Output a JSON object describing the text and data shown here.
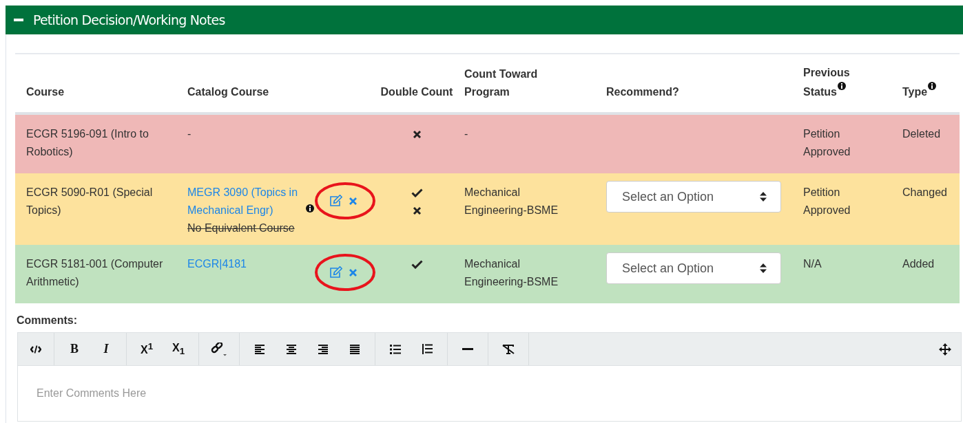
{
  "panel": {
    "title": "Petition Decision/Working Notes",
    "expanded": true
  },
  "table": {
    "columns": [
      {
        "label": "Course"
      },
      {
        "label": "Catalog Course"
      },
      {
        "label": "Double Count"
      },
      {
        "label": "Count Toward Program"
      },
      {
        "label": "Recommend?"
      },
      {
        "label": "Previous Status",
        "info": true
      },
      {
        "label": "Type",
        "info": true
      }
    ],
    "rows": [
      {
        "color": "#efb8b7",
        "course": "ECGR 5196-091 (Intro to Robotics)",
        "catalog": [
          {
            "text": "-",
            "kind": "plain"
          }
        ],
        "actions": false,
        "double_count": [
          {
            "kind": "cross"
          }
        ],
        "program": "-",
        "recommend": null,
        "previous_status": "Petition Approved",
        "type": "Deleted"
      },
      {
        "color": "#fde29d",
        "course": "ECGR 5090-R01 (Special Topics)",
        "catalog": [
          {
            "text": "MEGR 3090 (Topics in Mechanical Engr)",
            "kind": "link",
            "info": true
          },
          {
            "text": "No Equivalent Course",
            "kind": "struck"
          }
        ],
        "actions": true,
        "highlighted": true,
        "double_count": [
          {
            "kind": "check"
          },
          {
            "kind": "cross"
          }
        ],
        "program": "Mechanical Engineering-BSME",
        "recommend": {
          "placeholder": "Select an Option"
        },
        "previous_status": "Petition Approved",
        "type": "Changed"
      },
      {
        "color": "#c0e2bf",
        "course": "ECGR 5181-001 (Computer Arithmetic)",
        "catalog": [
          {
            "text": "ECGR|4181",
            "kind": "link"
          }
        ],
        "actions": true,
        "highlighted": true,
        "double_count": [
          {
            "kind": "check"
          }
        ],
        "program": "Mechanical Engineering-BSME",
        "recommend": {
          "placeholder": "Select an Option"
        },
        "previous_status": "N/A",
        "type": "Added"
      }
    ]
  },
  "comments": {
    "label": "Comments:",
    "placeholder": "Enter Comments Here",
    "toolbar": [
      [
        {
          "kind": "code"
        }
      ],
      [
        {
          "kind": "bold",
          "label": "B"
        },
        {
          "kind": "italic",
          "label": "I"
        }
      ],
      [
        {
          "kind": "superscript",
          "label": "X$^{1}$"
        },
        {
          "kind": "subscript",
          "label": "X$_{1}$"
        }
      ],
      [
        {
          "kind": "link"
        }
      ],
      [
        {
          "kind": "align-left"
        },
        {
          "kind": "align-center"
        },
        {
          "kind": "align-right"
        },
        {
          "kind": "justify"
        }
      ],
      [
        {
          "kind": "bullet-list"
        },
        {
          "kind": "number-list"
        }
      ],
      [
        {
          "kind": "rule"
        }
      ],
      [
        {
          "kind": "clear-format"
        }
      ]
    ]
  }
}
